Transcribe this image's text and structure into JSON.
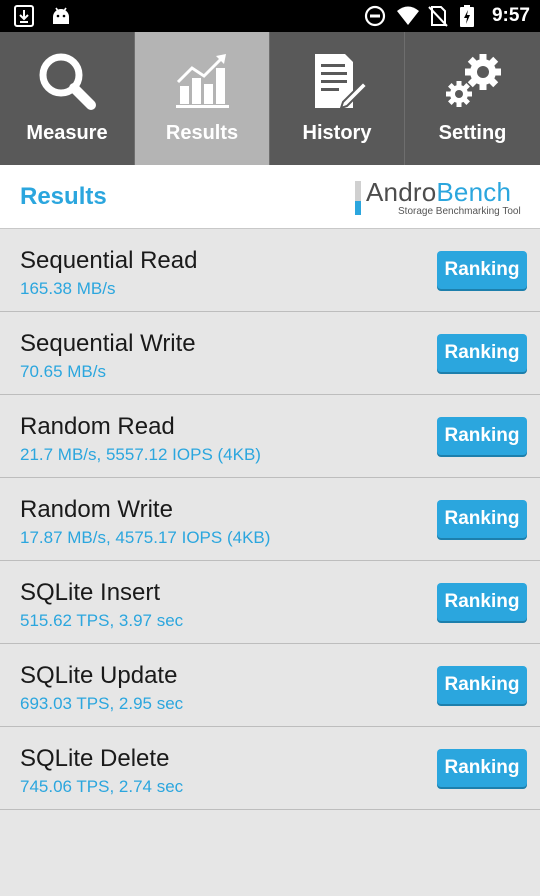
{
  "status_bar": {
    "time": "9:57",
    "left_icons": [
      "download-icon",
      "android-icon"
    ],
    "right_icons": [
      "do-not-disturb-icon",
      "wifi-icon",
      "no-sim-icon",
      "battery-charging-icon"
    ]
  },
  "tabs": [
    {
      "label": "Measure",
      "icon": "magnifier-icon",
      "active": false
    },
    {
      "label": "Results",
      "icon": "bar-chart-icon",
      "active": true
    },
    {
      "label": "History",
      "icon": "document-pen-icon",
      "active": false
    },
    {
      "label": "Setting",
      "icon": "gears-icon",
      "active": false
    }
  ],
  "header": {
    "title": "Results",
    "logo": {
      "part1": "Andro",
      "part2": "Bench",
      "subtitle": "Storage Benchmarking Tool"
    }
  },
  "results": [
    {
      "name": "Sequential Read",
      "value": "165.38 MB/s",
      "button": "Ranking"
    },
    {
      "name": "Sequential Write",
      "value": "70.65 MB/s",
      "button": "Ranking"
    },
    {
      "name": "Random Read",
      "value": "21.7 MB/s, 5557.12 IOPS (4KB)",
      "button": "Ranking"
    },
    {
      "name": "Random Write",
      "value": "17.87 MB/s, 4575.17 IOPS (4KB)",
      "button": "Ranking"
    },
    {
      "name": "SQLite Insert",
      "value": "515.62 TPS, 3.97 sec",
      "button": "Ranking"
    },
    {
      "name": "SQLite Update",
      "value": "693.03 TPS, 2.95 sec",
      "button": "Ranking"
    },
    {
      "name": "SQLite Delete",
      "value": "745.06 TPS, 2.74 sec",
      "button": "Ranking"
    }
  ],
  "colors": {
    "accent": "#2ba6de",
    "tabbar": "#595959",
    "tab_active": "#b4b4b4",
    "background": "#e6e6e6"
  }
}
